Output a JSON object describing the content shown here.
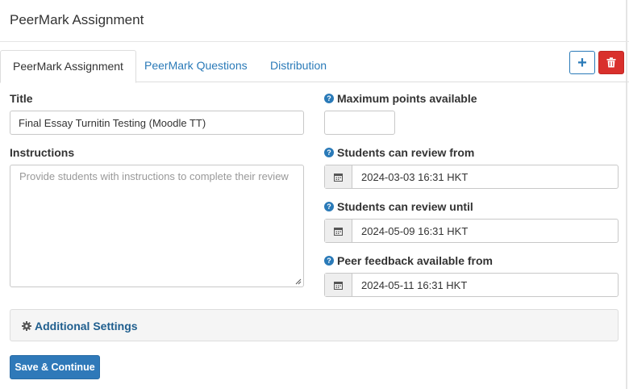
{
  "header": {
    "title": "PeerMark Assignment"
  },
  "tabs": [
    {
      "label": "PeerMark Assignment",
      "active": true
    },
    {
      "label": "PeerMark Questions",
      "active": false
    },
    {
      "label": "Distribution",
      "active": false
    }
  ],
  "toolbar": {
    "add_icon": "+",
    "delete_icon": "trash-icon"
  },
  "form": {
    "title_label": "Title",
    "title_value": "Final Essay Turnitin Testing (Moodle TT)",
    "instructions_label": "Instructions",
    "instructions_placeholder": "Provide students with instructions to complete their review",
    "max_points_label": "Maximum points available",
    "max_points_value": "",
    "review_from_label": "Students can review from",
    "review_from_value": "2024-03-03 16:31 HKT",
    "review_until_label": "Students can review until",
    "review_until_value": "2024-05-09 16:31 HKT",
    "feedback_from_label": "Peer feedback available from",
    "feedback_from_value": "2024-05-11 16:31 HKT"
  },
  "additional_settings": {
    "label": "Additional Settings"
  },
  "actions": {
    "save_label": "Save & Continue"
  },
  "colors": {
    "accent": "#2a7ab8",
    "danger": "#d9302c",
    "primary_button": "#2f79b9"
  }
}
